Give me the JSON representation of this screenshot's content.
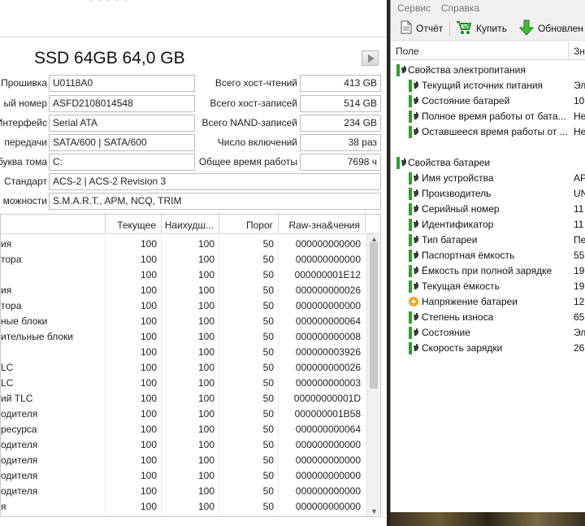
{
  "left": {
    "top_fragment": "· · · · ·",
    "disk_title": "SSD 64GB 64,0 GB",
    "fields_left": [
      {
        "label": "Прошивка",
        "value": "U0118A0"
      },
      {
        "label": "ый номер",
        "value": "ASFD2108014548"
      },
      {
        "label": "Интерфейс",
        "value": "Serial ATA"
      },
      {
        "label": "передачи",
        "value": "SATA/600 | SATA/600"
      },
      {
        "label": "буква тома",
        "value": "C:"
      }
    ],
    "fields_right": [
      {
        "label": "Всего хост-чтений",
        "value": "413 GB"
      },
      {
        "label": "Всего хост-записей",
        "value": "514 GB"
      },
      {
        "label": "Всего NAND-записей",
        "value": "234 GB"
      },
      {
        "label": "Число включений",
        "value": "38 раз"
      },
      {
        "label": "Общее время работы",
        "value": "7698 ч"
      }
    ],
    "standard": {
      "label": "Стандарт",
      "value": "ACS-2 | ACS-2 Revision 3"
    },
    "features": {
      "label": "можности",
      "value": "S.M.A.R.T., APM, NCQ, TRIM"
    },
    "table": {
      "headers": {
        "current": "Текущее",
        "worst": "Наихудш...",
        "threshold": "Порог",
        "raw": "Raw-зна&чения"
      },
      "rows": [
        {
          "name": "ия",
          "cur": "100",
          "worst": "100",
          "thr": "50",
          "raw": "000000000000"
        },
        {
          "name": "тора",
          "cur": "100",
          "worst": "100",
          "thr": "50",
          "raw": "000000000000"
        },
        {
          "name": "",
          "cur": "100",
          "worst": "100",
          "thr": "50",
          "raw": "000000001E12"
        },
        {
          "name": "ия",
          "cur": "100",
          "worst": "100",
          "thr": "50",
          "raw": "000000000026"
        },
        {
          "name": "тора",
          "cur": "100",
          "worst": "100",
          "thr": "50",
          "raw": "000000000000"
        },
        {
          "name": "ные блоки",
          "cur": "100",
          "worst": "100",
          "thr": "50",
          "raw": "000000000064"
        },
        {
          "name": "ительные блоки",
          "cur": "100",
          "worst": "100",
          "thr": "50",
          "raw": "000000000008"
        },
        {
          "name": "",
          "cur": "100",
          "worst": "100",
          "thr": "50",
          "raw": "000000003926"
        },
        {
          "name": "LC",
          "cur": "100",
          "worst": "100",
          "thr": "50",
          "raw": "000000000026"
        },
        {
          "name": "LC",
          "cur": "100",
          "worst": "100",
          "thr": "50",
          "raw": "000000000003"
        },
        {
          "name": "ий TLC",
          "cur": "100",
          "worst": "100",
          "thr": "50",
          "raw": "00000000001D"
        },
        {
          "name": "одителя",
          "cur": "100",
          "worst": "100",
          "thr": "50",
          "raw": "000000001B58"
        },
        {
          "name": "ресурса",
          "cur": "100",
          "worst": "100",
          "thr": "50",
          "raw": "000000000064"
        },
        {
          "name": "одителя",
          "cur": "100",
          "worst": "100",
          "thr": "50",
          "raw": "000000000000"
        },
        {
          "name": "одителя",
          "cur": "100",
          "worst": "100",
          "thr": "50",
          "raw": "000000000000"
        },
        {
          "name": "одителя",
          "cur": "100",
          "worst": "100",
          "thr": "50",
          "raw": "000000000000"
        },
        {
          "name": "одителя",
          "cur": "100",
          "worst": "100",
          "thr": "50",
          "raw": "000000000000"
        },
        {
          "name": "я",
          "cur": "100",
          "worst": "100",
          "thr": "50",
          "raw": "000000000000"
        }
      ]
    }
  },
  "right": {
    "menu": [
      "Сервис",
      "Справка"
    ],
    "toolbar": {
      "report": "Отчёт",
      "buy": "Купить",
      "update": "Обновлен"
    },
    "header": {
      "field": "Поле",
      "value": "Зн"
    },
    "groups": [
      {
        "title": "Свойства электропитания",
        "items": [
          {
            "name": "Текущий источник питания",
            "value": "Эл"
          },
          {
            "name": "Состояние батарей",
            "value": "10"
          },
          {
            "name": "Полное время работы от бата...",
            "value": "Не"
          },
          {
            "name": "Оставшееся время работы от ...",
            "value": "Не"
          }
        ]
      },
      {
        "title": "Свойства батареи",
        "items": [
          {
            "name": "Имя устройства",
            "value": "AP"
          },
          {
            "name": "Производитель",
            "value": "UN"
          },
          {
            "name": "Серийный номер",
            "value": "11"
          },
          {
            "name": "Идентификатор",
            "value": "11"
          },
          {
            "name": "Тип батареи",
            "value": "Пе"
          },
          {
            "name": "Паспортная ёмкость",
            "value": "55"
          },
          {
            "name": "Ёмкость при полной зарядке",
            "value": "19"
          },
          {
            "name": "Текущая ёмкость",
            "value": "19"
          },
          {
            "name": "Напряжение батареи",
            "value": "12."
          },
          {
            "name": "Степень износа",
            "value": "65"
          },
          {
            "name": "Состояние",
            "value": "Эл"
          },
          {
            "name": "Скорость зарядки",
            "value": "26"
          }
        ]
      }
    ]
  }
}
